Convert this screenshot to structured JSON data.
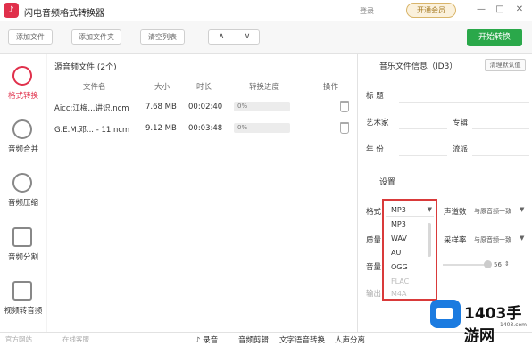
{
  "window": {
    "title": "闪电音频格式转换器",
    "link1": "登录",
    "vip": "开通会员",
    "minimize": "—",
    "maximize": "□",
    "close": "✕"
  },
  "toolbar": {
    "add_file": "添加文件",
    "add_folder": "添加文件夹",
    "clear_list": "清空列表",
    "up": "∧",
    "down": "∨",
    "start": "开始转换"
  },
  "sidebar": {
    "items": [
      {
        "label": "格式转换",
        "icon": "convert-icon"
      },
      {
        "label": "音频合并",
        "icon": "merge-icon"
      },
      {
        "label": "音频压缩",
        "icon": "compress-icon"
      },
      {
        "label": "音频分割",
        "icon": "split-icon"
      },
      {
        "label": "视频转音频",
        "icon": "video-icon"
      }
    ]
  },
  "filelist": {
    "title": "源音频文件 (2个)",
    "headers": [
      "文件名",
      "大小",
      "时长",
      "转换进度",
      "操作"
    ],
    "rows": [
      {
        "name": "Aicc;江梅...讲识.ncm",
        "size": "7.68 MB",
        "duration": "00:02:40",
        "progress": "0%"
      },
      {
        "name": "G.E.M.邓... - 11.ncm",
        "size": "9.12 MB",
        "duration": "00:03:48",
        "progress": "0%"
      }
    ]
  },
  "info": {
    "title": "音乐文件信息（ID3）",
    "reset": "清理默认值",
    "title_label": "标   题",
    "artist_label": "艺术家",
    "album_label": "专辑",
    "year_label": "年   份",
    "genre_label": "流派"
  },
  "settings": {
    "title": "设置",
    "format_label": "格式",
    "channels_label": "声道数",
    "channels_value": "与原音频一致",
    "quality_label": "质量",
    "samplerate_label": "采样率",
    "samplerate_value": "与原音频一致",
    "volume_label": "音量",
    "volume_value": "56",
    "output_label": "输出"
  },
  "dropdown": {
    "selected": "MP3",
    "options": [
      "MP3",
      "WAV",
      "AU",
      "OGG",
      "FLAC",
      "M4A"
    ]
  },
  "status": {
    "site": "官方网站",
    "support": "在线客服",
    "record": "录音",
    "edit": "音频剪辑",
    "speech": "文字语音转换",
    "vocal": "人声分离"
  },
  "watermark": {
    "brand": "1403手游网",
    "domain": "1403.com"
  }
}
